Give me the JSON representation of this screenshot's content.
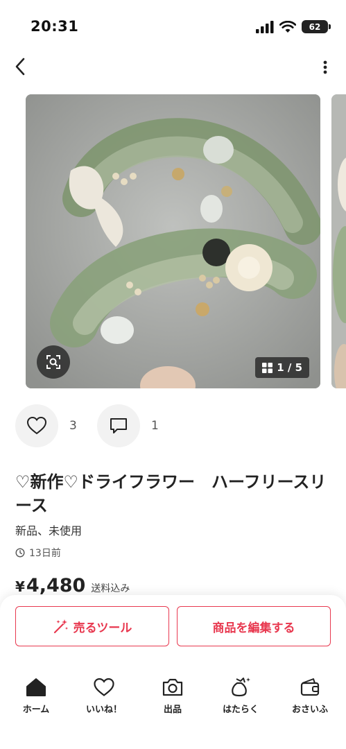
{
  "status_bar": {
    "time": "20:31",
    "battery": "62"
  },
  "gallery": {
    "counter": "1 / 5"
  },
  "likes": {
    "count": "3"
  },
  "comments": {
    "count": "1"
  },
  "item": {
    "title": "♡新作♡ドライフラワー　ハーフリースリース",
    "condition": "新品、未使用",
    "posted": "13日前",
    "price_symbol": "¥",
    "price": "4,480",
    "price_note": "送料込み"
  },
  "buttons": {
    "sell_tool": "売るツール",
    "edit_item": "商品を編集する"
  },
  "tabs": [
    {
      "label": "ホーム",
      "icon": "home-icon"
    },
    {
      "label": "いいね！",
      "icon": "heart-icon"
    },
    {
      "label": "出品",
      "icon": "camera-icon"
    },
    {
      "label": "はたらく",
      "icon": "money-bag-icon"
    },
    {
      "label": "おさいふ",
      "icon": "wallet-icon"
    }
  ],
  "colors": {
    "accent": "#e8384f",
    "text": "#222222"
  }
}
